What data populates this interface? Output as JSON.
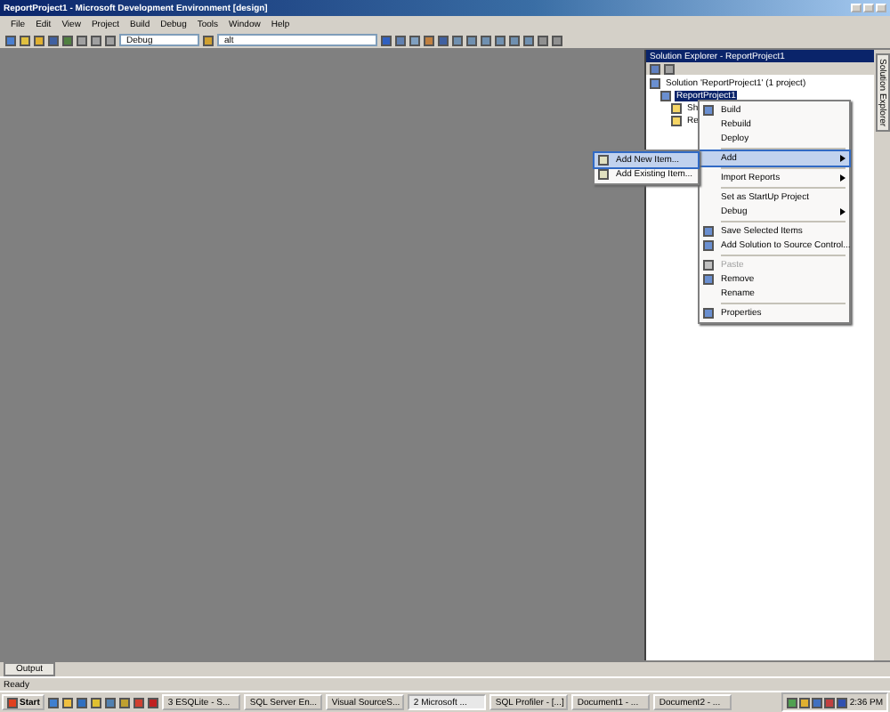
{
  "window": {
    "title": "ReportProject1 - Microsoft Development Environment [design]"
  },
  "menu_bar": [
    "File",
    "Edit",
    "View",
    "Project",
    "Build",
    "Debug",
    "Tools",
    "Window",
    "Help"
  ],
  "toolbar": {
    "configuration": "Debug",
    "find": "alt"
  },
  "solution_explorer": {
    "title": "Solution Explorer - ReportProject1",
    "tree": [
      {
        "label": "Solution 'ReportProject1' (1 project)",
        "selected": false,
        "children": [
          {
            "label": "ReportProject1",
            "selected": true,
            "children": [
              {
                "label": "Sh",
                "selected": false
              },
              {
                "label": "Re",
                "selected": false
              }
            ]
          }
        ]
      }
    ]
  },
  "side_tab": "Solution Explorer",
  "context_menu": [
    {
      "kind": "item",
      "label": "Build",
      "icon": true,
      "selected": false,
      "disabled": false,
      "submenu": false
    },
    {
      "kind": "item",
      "label": "Rebuild",
      "icon": false,
      "selected": false,
      "disabled": false,
      "submenu": false
    },
    {
      "kind": "item",
      "label": "Deploy",
      "icon": false,
      "selected": false,
      "disabled": false,
      "submenu": false
    },
    {
      "kind": "separator"
    },
    {
      "kind": "item",
      "label": "Add",
      "icon": false,
      "selected": true,
      "disabled": false,
      "submenu": true
    },
    {
      "kind": "separator"
    },
    {
      "kind": "item",
      "label": "Import Reports",
      "icon": false,
      "selected": false,
      "disabled": false,
      "submenu": true
    },
    {
      "kind": "separator"
    },
    {
      "kind": "item",
      "label": "Set as StartUp Project",
      "icon": false,
      "selected": false,
      "disabled": false,
      "submenu": false
    },
    {
      "kind": "item",
      "label": "Debug",
      "icon": false,
      "selected": false,
      "disabled": false,
      "submenu": true
    },
    {
      "kind": "separator"
    },
    {
      "kind": "item",
      "label": "Save Selected Items",
      "icon": true,
      "selected": false,
      "disabled": false,
      "submenu": false
    },
    {
      "kind": "item",
      "label": "Add Solution to Source Control...",
      "icon": true,
      "selected": false,
      "disabled": false,
      "submenu": false
    },
    {
      "kind": "separator"
    },
    {
      "kind": "item",
      "label": "Paste",
      "icon": true,
      "selected": false,
      "disabled": true,
      "submenu": false
    },
    {
      "kind": "item",
      "label": "Remove",
      "icon": true,
      "selected": false,
      "disabled": false,
      "submenu": false
    },
    {
      "kind": "item",
      "label": "Rename",
      "icon": false,
      "selected": false,
      "disabled": false,
      "submenu": false
    },
    {
      "kind": "separator"
    },
    {
      "kind": "item",
      "label": "Properties",
      "icon": true,
      "selected": false,
      "disabled": false,
      "submenu": false
    }
  ],
  "submenu": [
    {
      "label": "Add New Item...",
      "selected": true
    },
    {
      "label": "Add Existing Item...",
      "selected": false
    }
  ],
  "output_tab": "Output",
  "status_bar": "Ready",
  "taskbar": {
    "start": "Start",
    "buttons": [
      {
        "label": "3 ESQLite - S...",
        "selected": false
      },
      {
        "label": "SQL Server En...",
        "selected": false
      },
      {
        "label": "Visual SourceS...",
        "selected": false
      },
      {
        "label": "2 Microsoft ...",
        "selected": true
      },
      {
        "label": "SQL Profiler - [...]",
        "selected": false
      },
      {
        "label": "Document1 - ...",
        "selected": false
      },
      {
        "label": "Document2 - ...",
        "selected": false
      }
    ],
    "clock": "2:36 PM"
  }
}
